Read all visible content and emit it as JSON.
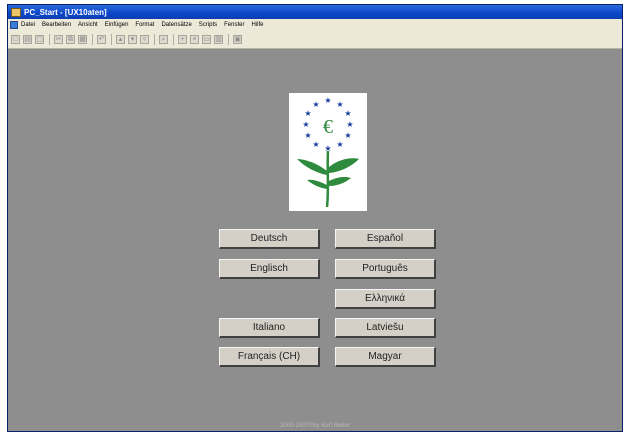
{
  "window": {
    "title": "PC_Start - [UX10aten]"
  },
  "menu": [
    "Datei",
    "Bearbeiten",
    "Ansicht",
    "Einfügen",
    "Format",
    "Datensätze",
    "Scripts",
    "Fenster",
    "Hilfe"
  ],
  "toolbar_icons": [
    "new-icon",
    "print-icon",
    "preview-icon",
    "cut-icon",
    "copy-icon",
    "paste-icon",
    "undo-icon",
    "sort-asc-icon",
    "sort-desc-icon",
    "filter-icon",
    "apply-filter-icon",
    "find-icon",
    "new-record-icon",
    "delete-record-icon",
    "window-icon",
    "layout-icon",
    "properties-icon"
  ],
  "languages": {
    "deutsch": "Deutsch",
    "espanol": "Español",
    "englisch": "Englisch",
    "portugues": "Português",
    "ellinika": "Ελληνικά",
    "italiano": "Italiano",
    "latviesu": "Latviešu",
    "francais": "Français (CH)",
    "magyar": "Magyar"
  },
  "logo": {
    "letter": "€",
    "icon": "eu-ecolabel-flower-icon",
    "star_color": "#1a3f9c",
    "stem_color": "#2e8b3e"
  },
  "footer": "2000-2007©by Kurt Reiter"
}
